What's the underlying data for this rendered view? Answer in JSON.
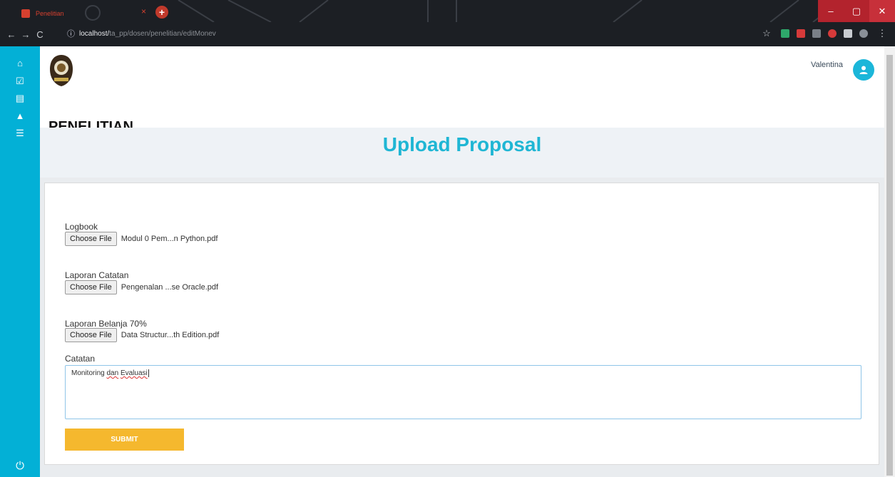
{
  "browser": {
    "tab_title": "Penelitian",
    "tab_close": "×",
    "new_tab": "+",
    "url_host": "localhost/",
    "url_path": "ta_pp/dosen/penelitian/editMonev"
  },
  "sidebar": {
    "items": [
      {
        "icon": "home-icon",
        "glyph": "⌂"
      },
      {
        "icon": "check-square-icon",
        "glyph": "☑"
      },
      {
        "icon": "document-icon",
        "glyph": "▤"
      },
      {
        "icon": "warning-icon",
        "glyph": "▲"
      },
      {
        "icon": "list-icon",
        "glyph": "☰"
      }
    ],
    "power_glyph": "⏻"
  },
  "header": {
    "brand": "PENELITIAN",
    "user_name": "Valentina"
  },
  "page": {
    "title": "Upload Proposal"
  },
  "form": {
    "fields": [
      {
        "label": "Logbook",
        "button": "Choose File",
        "file": "Modul 0 Pem...n Python.pdf"
      },
      {
        "label": "Laporan Catatan",
        "button": "Choose File",
        "file": "Pengenalan ...se Oracle.pdf"
      },
      {
        "label": "Laporan Belanja 70%",
        "button": "Choose File",
        "file": "Data Structur...th Edition.pdf"
      }
    ],
    "catatan_label": "Catatan",
    "catatan_value_a": "Monitoring ",
    "catatan_value_b": "dan",
    "catatan_value_c": " ",
    "catatan_value_d": "Evaluasi",
    "submit_label": "SUBMIT"
  },
  "colors": {
    "sidebar": "#03b0d6",
    "title": "#1fb6d4",
    "submit": "#f5b82e"
  }
}
